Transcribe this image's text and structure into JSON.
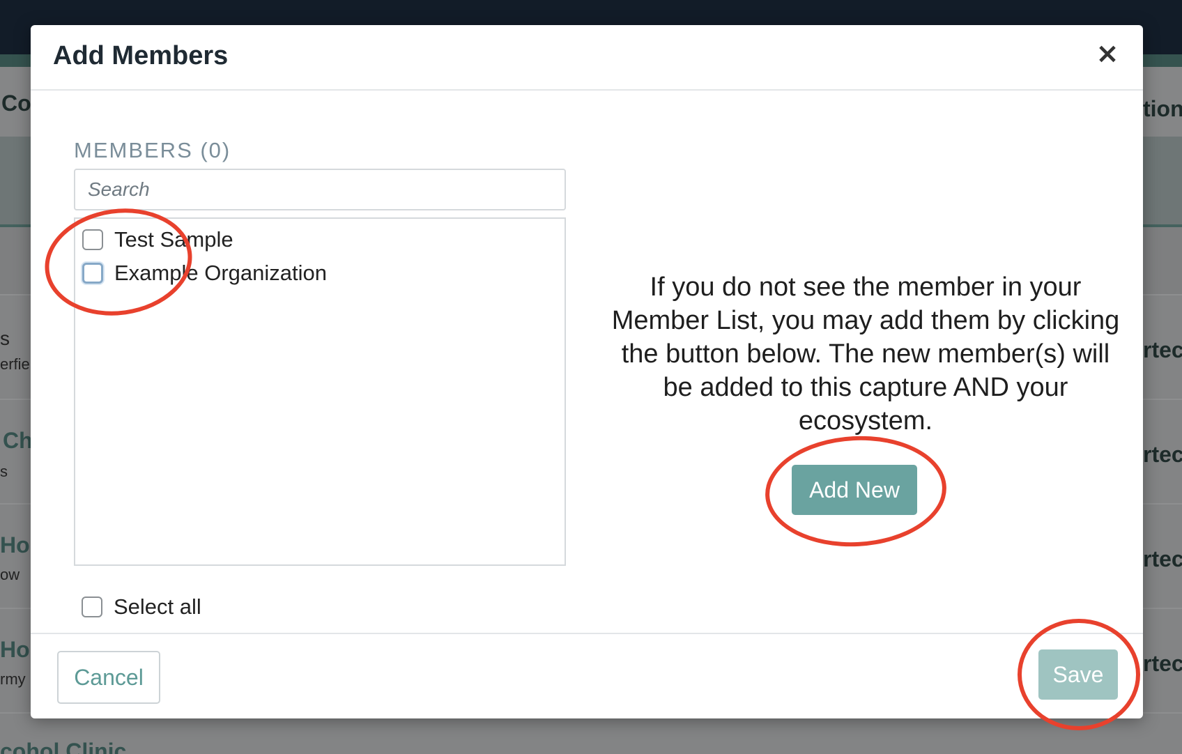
{
  "background": {
    "row_fragments_left": [
      "Co",
      "s",
      "erfie",
      "Ch",
      "s",
      "Hor",
      "ow",
      "Hou",
      "rmy",
      "cohol Clinic"
    ],
    "row_fragments_right": [
      "tion",
      "rtec",
      "rtec",
      "rtec",
      "rtec"
    ]
  },
  "modal": {
    "title": "Add Members",
    "close_symbol": "×",
    "members_label": "MEMBERS (0)",
    "search": {
      "placeholder": "Search",
      "value": ""
    },
    "members": [
      {
        "label": "Test Sample",
        "checked": false
      },
      {
        "label": "Example Organization",
        "checked": false
      }
    ],
    "select_all_label": "Select all",
    "info_text": "If you do not see the member in your Member List, you may add them by clicking the button below. The new member(s) will be added to this capture AND your ecosystem.",
    "add_new_label": "Add New",
    "cancel_label": "Cancel",
    "save_label": "Save"
  },
  "colors": {
    "accent_teal": "#6aa3a0",
    "save_disabled": "#9fc4c1",
    "annotation_red": "#e8412d",
    "topbar_navy": "#121c28"
  }
}
